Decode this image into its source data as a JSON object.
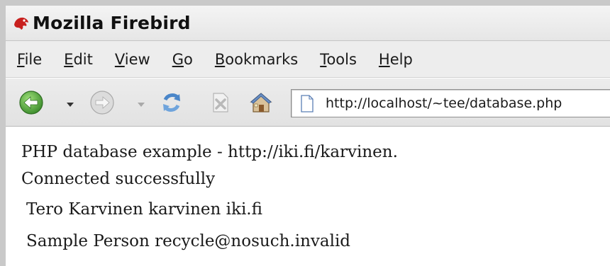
{
  "window": {
    "title": "Mozilla Firebird"
  },
  "menu": {
    "items": [
      {
        "mnemonic": "F",
        "rest": "ile"
      },
      {
        "mnemonic": "E",
        "rest": "dit"
      },
      {
        "mnemonic": "V",
        "rest": "iew"
      },
      {
        "mnemonic": "G",
        "rest": "o"
      },
      {
        "mnemonic": "B",
        "rest": "ookmarks"
      },
      {
        "mnemonic": "T",
        "rest": "ools"
      },
      {
        "mnemonic": "H",
        "rest": "elp"
      }
    ]
  },
  "toolbar": {
    "icons": [
      "back-icon",
      "back-dropdown-icon",
      "forward-icon",
      "forward-dropdown-icon",
      "reload-icon",
      "stop-icon",
      "home-icon",
      "page-icon"
    ]
  },
  "urlbar": {
    "value": "http://localhost/~tee/database.php"
  },
  "page": {
    "heading": "PHP database example - http://iki.fi/karvinen.",
    "status": "Connected successfully",
    "rows": [
      "Tero Karvinen karvinen iki.fi",
      "Sample Person recycle@nosuch.invalid"
    ]
  },
  "colors": {
    "back_arrow": "#3f8f2f",
    "forward_arrow": "#a9a9a9",
    "brand_icon": "#c8201e"
  }
}
